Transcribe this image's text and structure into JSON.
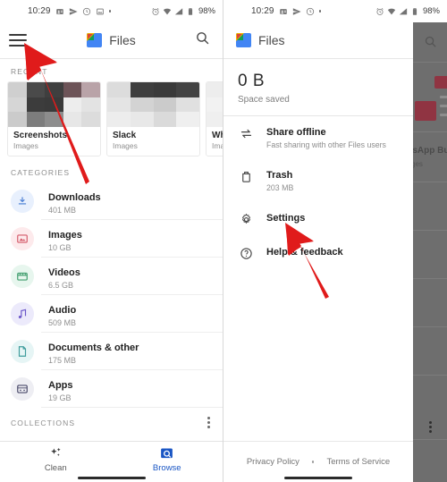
{
  "status_bar": {
    "time": "10:29",
    "left_icons": [
      "contacts-icon",
      "send-icon",
      "clock-circle-icon",
      "photo-icon",
      "dot-icon"
    ],
    "right_icons": [
      "alarm-icon",
      "wifi-icon",
      "signal-icon",
      "battery-icon"
    ],
    "battery_percent": "98%"
  },
  "left_screen": {
    "toolbar": {
      "menu_label": "Menu",
      "app_name": "Files",
      "search_label": "Search"
    },
    "recent": {
      "section_label": "RECENT",
      "items": [
        {
          "title": "Screenshots",
          "subtitle": "Images"
        },
        {
          "title": "Slack",
          "subtitle": "Images"
        },
        {
          "title": "WhatsApp Bu",
          "subtitle": "Images"
        }
      ]
    },
    "categories": {
      "section_label": "CATEGORIES",
      "items": [
        {
          "name": "Downloads",
          "size": "401 MB",
          "icon": "download-icon",
          "color": "#4a7fd4",
          "bg": "#e8f0fd"
        },
        {
          "name": "Images",
          "size": "10 GB",
          "icon": "image-icon",
          "color": "#d45a6a",
          "bg": "#fdeaec"
        },
        {
          "name": "Videos",
          "size": "6.5 GB",
          "icon": "video-icon",
          "color": "#3f9d6d",
          "bg": "#e7f6ee"
        },
        {
          "name": "Audio",
          "size": "509 MB",
          "icon": "audio-icon",
          "color": "#6b57c9",
          "bg": "#eceafb"
        },
        {
          "name": "Documents & other",
          "size": "175 MB",
          "icon": "document-icon",
          "color": "#3f9d9d",
          "bg": "#e6f5f5"
        },
        {
          "name": "Apps",
          "size": "19 GB",
          "icon": "apps-icon",
          "color": "#4a4a6a",
          "bg": "#eeeef3"
        }
      ]
    },
    "collections": {
      "section_label": "COLLECTIONS",
      "overflow_label": "More options"
    },
    "bottom_nav": [
      {
        "label": "Clean",
        "icon": "sparkle-icon",
        "active": false
      },
      {
        "label": "Browse",
        "icon": "browse-folder-icon",
        "active": true
      }
    ]
  },
  "right_screen": {
    "toolbar": {
      "app_name": "Files"
    },
    "space_saved": {
      "amount": "0 B",
      "label": "Space saved"
    },
    "drawer_items": [
      {
        "title": "Share offline",
        "subtitle": "Fast sharing with other Files users",
        "icon": "share-offline-icon"
      },
      {
        "title": "Trash",
        "subtitle": "203 MB",
        "icon": "trash-icon"
      },
      {
        "title": "Settings",
        "subtitle": "",
        "icon": "gear-icon"
      },
      {
        "title": "Help & feedback",
        "subtitle": "",
        "icon": "help-circle-icon"
      }
    ],
    "footer": {
      "privacy": "Privacy Policy",
      "terms": "Terms of Service"
    },
    "scrim": {
      "search_label": "Search",
      "ghost_recent_title": "tsApp Bu",
      "ghost_recent_sub": "ges"
    }
  },
  "annotations": {
    "arrow_color": "#e01b1b",
    "arrows": [
      {
        "name": "arrow-to-menu-button",
        "target": "hamburger menu"
      },
      {
        "name": "arrow-to-settings-item",
        "target": "Settings"
      }
    ]
  }
}
